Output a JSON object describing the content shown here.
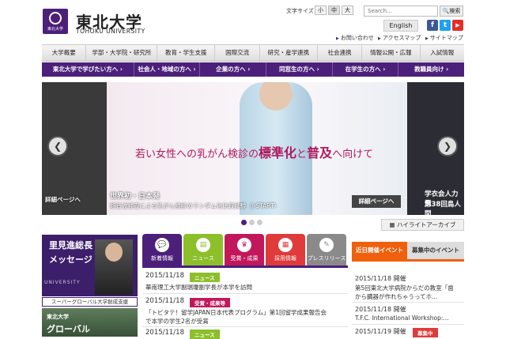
{
  "header": {
    "logo_ja": "東北大学",
    "logo_en": "TOHOKU UNIVERSITY",
    "logo_mark_text": "東北大学",
    "fontsize_label": "文字サイズ",
    "fontsize_options": [
      "小",
      "中",
      "大"
    ],
    "search_placeholder": "Search...",
    "search_button": "検索",
    "english": "English",
    "sns": {
      "facebook": "f",
      "twitter": "t",
      "youtube": "▶"
    },
    "links": [
      "お問い合わせ",
      "アクセスマップ",
      "サイトマップ"
    ]
  },
  "nav": {
    "items": [
      "大学概要",
      "学部・大学院・研究所",
      "教育・学生支援",
      "国際交流",
      "研究・産学連携",
      "社会連携",
      "情報公開・広報",
      "入試情報"
    ]
  },
  "subnav": {
    "items": [
      "東北大学で学びたい方へ",
      "社会人・地域の方へ",
      "企業の方へ",
      "同窓生の方へ",
      "在学生の方へ",
      "教職員向け"
    ]
  },
  "hero": {
    "headline_pre": "若い女性への乳がん検診の",
    "headline_em1": "標準化",
    "headline_mid": "と",
    "headline_em2": "普及",
    "headline_post": "へ向けて",
    "caption_title": "世界初・日本発",
    "caption_sub": "超音波検査による乳がん検診のランダム化比較試験（J-START）",
    "left_detail": "詳細ページへ",
    "main_detail": "詳細ページへ",
    "right_cap1": "学衣会人力飛",
    "right_cap2": "第38回鳥人間",
    "prev": "❮",
    "next": "❯",
    "dots": 3,
    "active_dot": 0,
    "highlight_archive": "ハイライトアーカイブ"
  },
  "president": {
    "line1": "里見進総長",
    "line2": "メッセージ",
    "univ_text": "UNIVERSITY",
    "sg_banner": "スーパーグローバル大学創成支援",
    "glob1": "東北大学",
    "glob2": "グローバル"
  },
  "news": {
    "tabs": [
      {
        "label": "新着情報",
        "icon": "💬",
        "color": "#4b1f7a",
        "text_color": "#ffffff"
      },
      {
        "label": "ニュース",
        "icon": "▤",
        "color": "#8dbf2b",
        "text_color": "#ffffff"
      },
      {
        "label": "受賞・成果",
        "icon": "♛",
        "color": "#c2185b",
        "text_color": "#ffffff"
      },
      {
        "label": "採用情報",
        "icon": "▦",
        "color": "#e03a3a",
        "text_color": "#ffffff"
      },
      {
        "label": "プレスリリース",
        "icon": "✎",
        "color": "#8a8a8a",
        "text_color": "#ffffff"
      }
    ],
    "items": [
      {
        "date": "2015/11/18",
        "badge": "ニュース",
        "badge_color": "#8dbf2b",
        "text1": "華南理工大学副瑞瓊副学長が本学を訪問",
        "text2": ""
      },
      {
        "date": "2015/11/18",
        "badge": "受賞・成果等",
        "badge_color": "#c2185b",
        "text1": "「トビタテ！留学JAPAN日本代表プログラム」第1回留学成果報告会",
        "text2": "で本学の学生2名が受賞"
      },
      {
        "date": "2015/11/18",
        "badge": "ニュース",
        "badge_color": "#8dbf2b",
        "text1": "",
        "text2": ""
      }
    ]
  },
  "events": {
    "tab_recent": "近日開催イベント",
    "tab_recruit": "募集中のイベント",
    "items": [
      {
        "date": "2015/11/18 開催",
        "line1": "第5回東北大学病院からだの教室「歯",
        "line2": "から臓器が作れちゃうってホ...",
        "badge": ""
      },
      {
        "date": "2015/11/18 開催",
        "line1": "T.F.C. International Workshop:...",
        "line2": "",
        "badge": ""
      },
      {
        "date": "2015/11/19 開催",
        "line1": "",
        "line2": "",
        "badge": "募集中"
      }
    ]
  }
}
